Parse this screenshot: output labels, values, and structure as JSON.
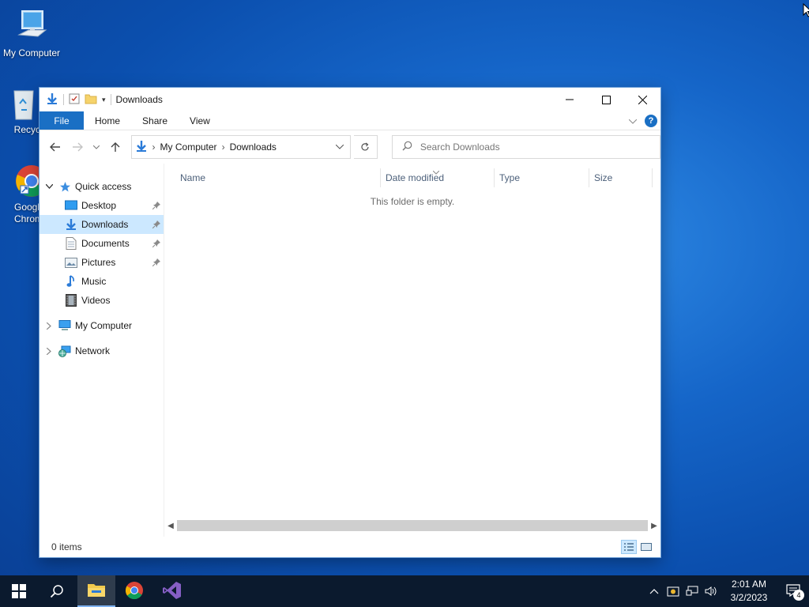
{
  "desktop": {
    "icons": [
      {
        "label": "My Computer"
      },
      {
        "label": "Recycle"
      },
      {
        "label": "Googl\nChrom"
      }
    ]
  },
  "window": {
    "title": "Downloads",
    "ribbon": {
      "tabs": [
        "File",
        "Home",
        "Share",
        "View"
      ],
      "help": "?"
    },
    "address": {
      "crumbs": [
        "My Computer",
        "Downloads"
      ]
    },
    "search": {
      "placeholder": "Search Downloads"
    },
    "navpane": {
      "quick_access": "Quick access",
      "items": [
        {
          "label": "Desktop",
          "pinned": true
        },
        {
          "label": "Downloads",
          "pinned": true,
          "selected": true
        },
        {
          "label": "Documents",
          "pinned": true
        },
        {
          "label": "Pictures",
          "pinned": true
        },
        {
          "label": "Music"
        },
        {
          "label": "Videos"
        }
      ],
      "my_computer": "My Computer",
      "network": "Network"
    },
    "columns": [
      "Name",
      "Date modified",
      "Type",
      "Size"
    ],
    "empty_message": "This folder is empty.",
    "status": "0 items"
  },
  "taskbar": {
    "clock_time": "2:01 AM",
    "clock_date": "3/2/2023",
    "notification_count": "4"
  },
  "colors": {
    "accent": "#1a6fc4",
    "selection": "#cce8ff",
    "taskbar": "#0b1a2e"
  }
}
